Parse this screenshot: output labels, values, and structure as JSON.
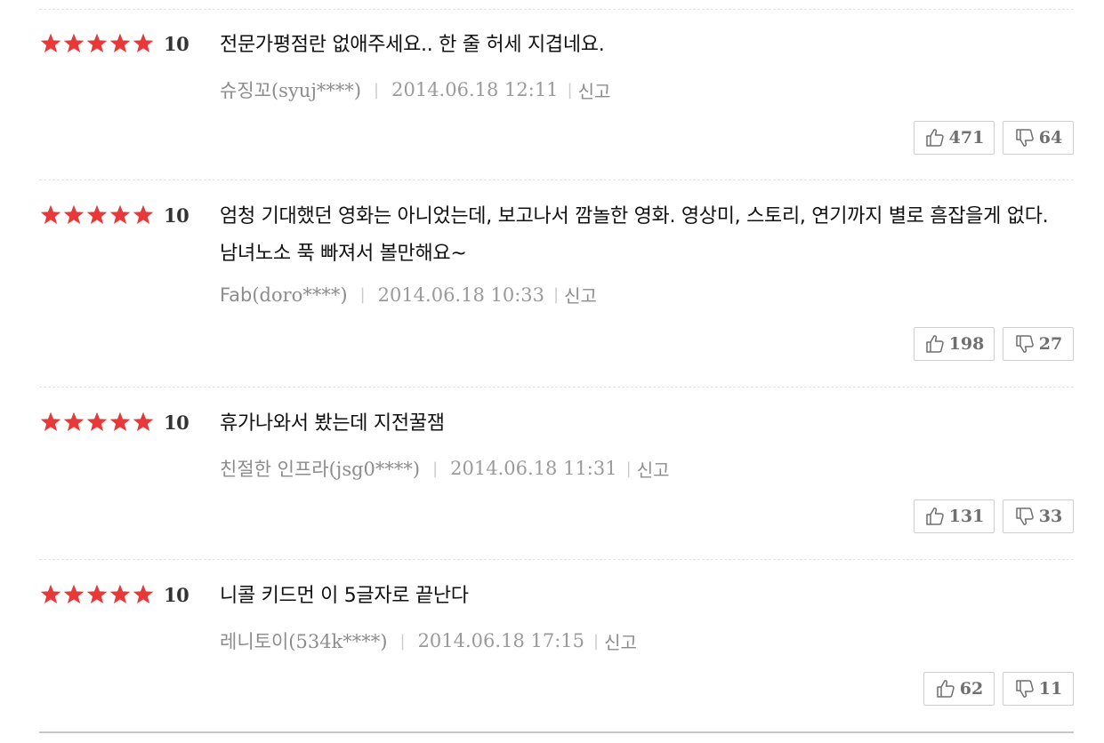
{
  "colors": {
    "star": "#e8393a",
    "text": "#111111",
    "meta": "#8c8c8c",
    "count": "#6f6f6f"
  },
  "reviews": [
    {
      "stars": 5,
      "score": "10",
      "comment": "전문가평점란 없애주세요.. 한 줄 허세 지겹네요.",
      "author": "슈징꼬",
      "user_id": "(syuj****)",
      "date": "2014.06.18 12:11",
      "report_label": "신고",
      "likes": "471",
      "dislikes": "64"
    },
    {
      "stars": 5,
      "score": "10",
      "comment": "엄청 기대했던 영화는 아니었는데, 보고나서 깜놀한 영화. 영상미, 스토리, 연기까지 별로 흠잡을게 없다. 남녀노소 푹 빠져서 볼만해요~",
      "author": "Fab",
      "user_id": "(doro****)",
      "date": "2014.06.18 10:33",
      "report_label": "신고",
      "likes": "198",
      "dislikes": "27"
    },
    {
      "stars": 5,
      "score": "10",
      "comment": "휴가나와서 봤는데 지전꿀잼",
      "author": "친절한 인프라",
      "user_id": "(jsg0****)",
      "date": "2014.06.18 11:31",
      "report_label": "신고",
      "likes": "131",
      "dislikes": "33"
    },
    {
      "stars": 5,
      "score": "10",
      "comment": "니콜 키드먼 이 5글자로 끝난다",
      "author": "레니토이",
      "user_id": "(534k****)",
      "date": "2014.06.18 17:15",
      "report_label": "신고",
      "likes": "62",
      "dislikes": "11"
    }
  ]
}
